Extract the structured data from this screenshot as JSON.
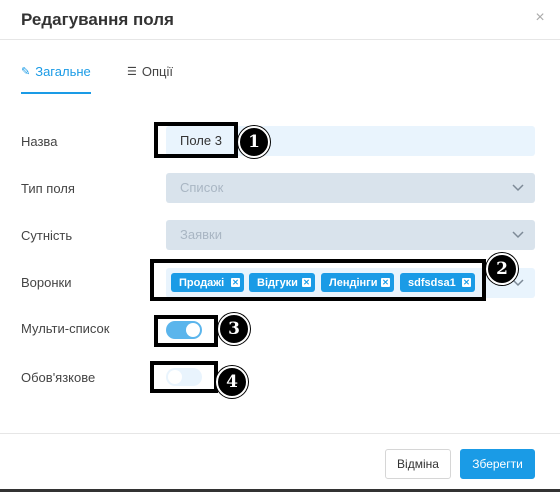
{
  "dialog": {
    "title": "Редагування поля",
    "close_icon": "×"
  },
  "tabs": [
    {
      "label": "Загальне",
      "icon": "edit-icon",
      "glyph": "✎",
      "active": true
    },
    {
      "label": "Опції",
      "icon": "list-icon",
      "glyph": "☰",
      "active": false
    }
  ],
  "form": {
    "name": {
      "label": "Назва",
      "value": "Поле 3"
    },
    "type": {
      "label": "Тип поля",
      "value": "Список"
    },
    "entity": {
      "label": "Сутність",
      "value": "Заявки"
    },
    "funnels": {
      "label": "Воронки",
      "tags": [
        "Продажі",
        "Відгуки",
        "Лендінги",
        "sdfsdsa1"
      ]
    },
    "multi": {
      "label": "Мульти-список",
      "enabled": true
    },
    "required": {
      "label": "Обов'язкове",
      "enabled": false
    }
  },
  "annotations": [
    "1",
    "2",
    "3",
    "4"
  ],
  "footer": {
    "cancel_label": "Відміна",
    "save_label": "Зберегти"
  },
  "colors": {
    "accent": "#1a9be6",
    "field_bg": "#e9f4fd",
    "disabled_bg": "#d9e3ec"
  }
}
